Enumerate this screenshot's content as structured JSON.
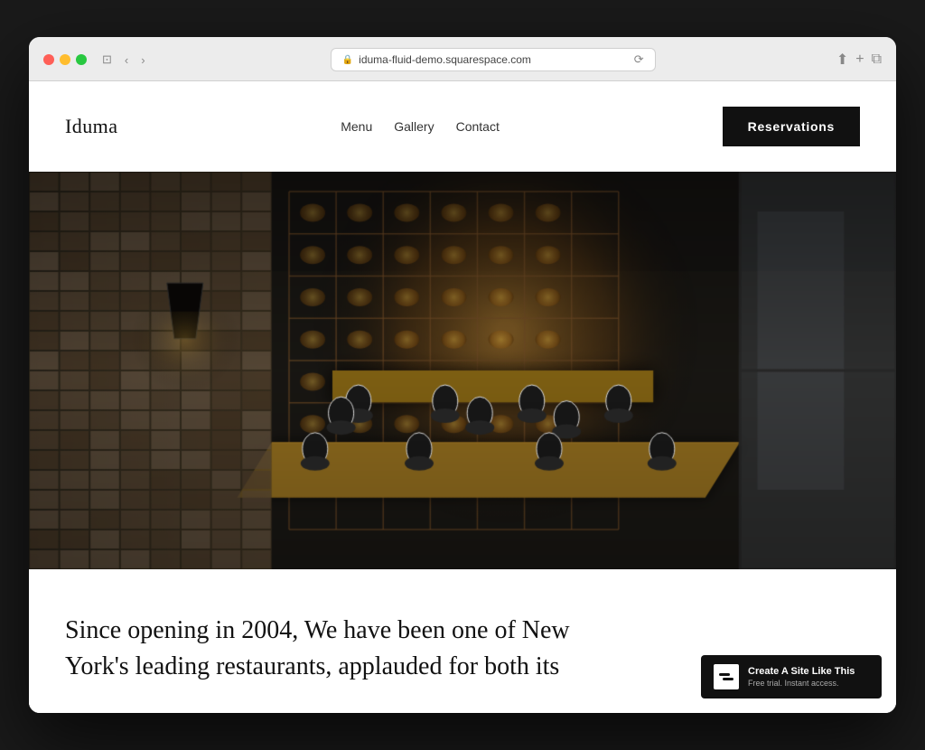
{
  "browser": {
    "url": "iduma-fluid-demo.squarespace.com",
    "refresh_icon": "⟳",
    "back_icon": "‹",
    "forward_icon": "›",
    "window_icon": "⊡",
    "share_icon": "⬆",
    "new_tab_icon": "+",
    "tab_icon": "⧉"
  },
  "site": {
    "logo": "Iduma",
    "nav": {
      "items": [
        {
          "label": "Menu"
        },
        {
          "label": "Gallery"
        },
        {
          "label": "Contact"
        }
      ],
      "cta_label": "Reservations"
    },
    "body_text": "Since opening in 2004, We have been one of New York's leading restaurants, applauded for both its",
    "badge": {
      "title": "Create A Site Like This",
      "subtitle": "Free trial. Instant access."
    }
  },
  "colors": {
    "nav_cta_bg": "#111111",
    "nav_cta_text": "#ffffff",
    "logo_color": "#111111",
    "body_bg": "#ffffff",
    "badge_bg": "#111111"
  }
}
